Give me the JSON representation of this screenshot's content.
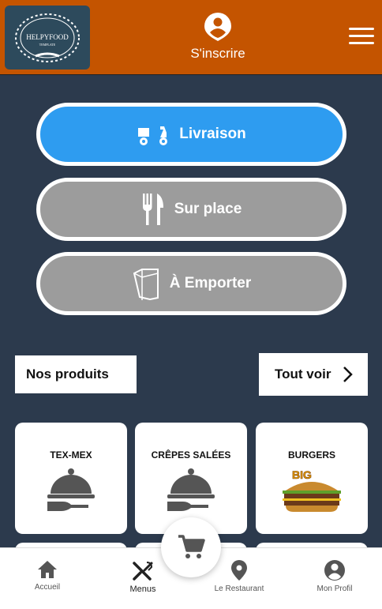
{
  "header": {
    "logo_text": "HELPYFOOD",
    "logo_subtext": "TEMPLATE",
    "signup_label": "S'inscrire",
    "colors": {
      "background": "#c45400",
      "logo_bg": "#2d4a5c"
    }
  },
  "modes": [
    {
      "label": "Livraison",
      "icon": "scooter-icon",
      "color": "#2e9cf0",
      "selected": true
    },
    {
      "label": "Sur place",
      "icon": "cutlery-icon",
      "color": "#9c9c9c",
      "selected": false
    },
    {
      "label": "À Emporter",
      "icon": "bag-icon",
      "color": "#9c9c9c",
      "selected": false
    }
  ],
  "products_section": {
    "title": "Nos produits",
    "see_all": "Tout voir"
  },
  "categories": [
    {
      "label": "TEX-MEX",
      "icon": "cloche-icon"
    },
    {
      "label": "CRÊPES SALÉES",
      "icon": "cloche-icon"
    },
    {
      "label": "BURGERS",
      "icon": "burger-image",
      "image_text": "BIG"
    }
  ],
  "bottom_nav": [
    {
      "label": "Accueil",
      "icon": "home-icon"
    },
    {
      "label": "Menus",
      "icon": "restaurant-icon",
      "active": true
    },
    {
      "label": "Le Restaurant",
      "icon": "location-pin-icon"
    },
    {
      "label": "Mon Profil",
      "icon": "account-circle-icon"
    }
  ],
  "cart": {
    "icon": "shopping-cart-icon"
  },
  "page_bg": "#2c3a4d"
}
